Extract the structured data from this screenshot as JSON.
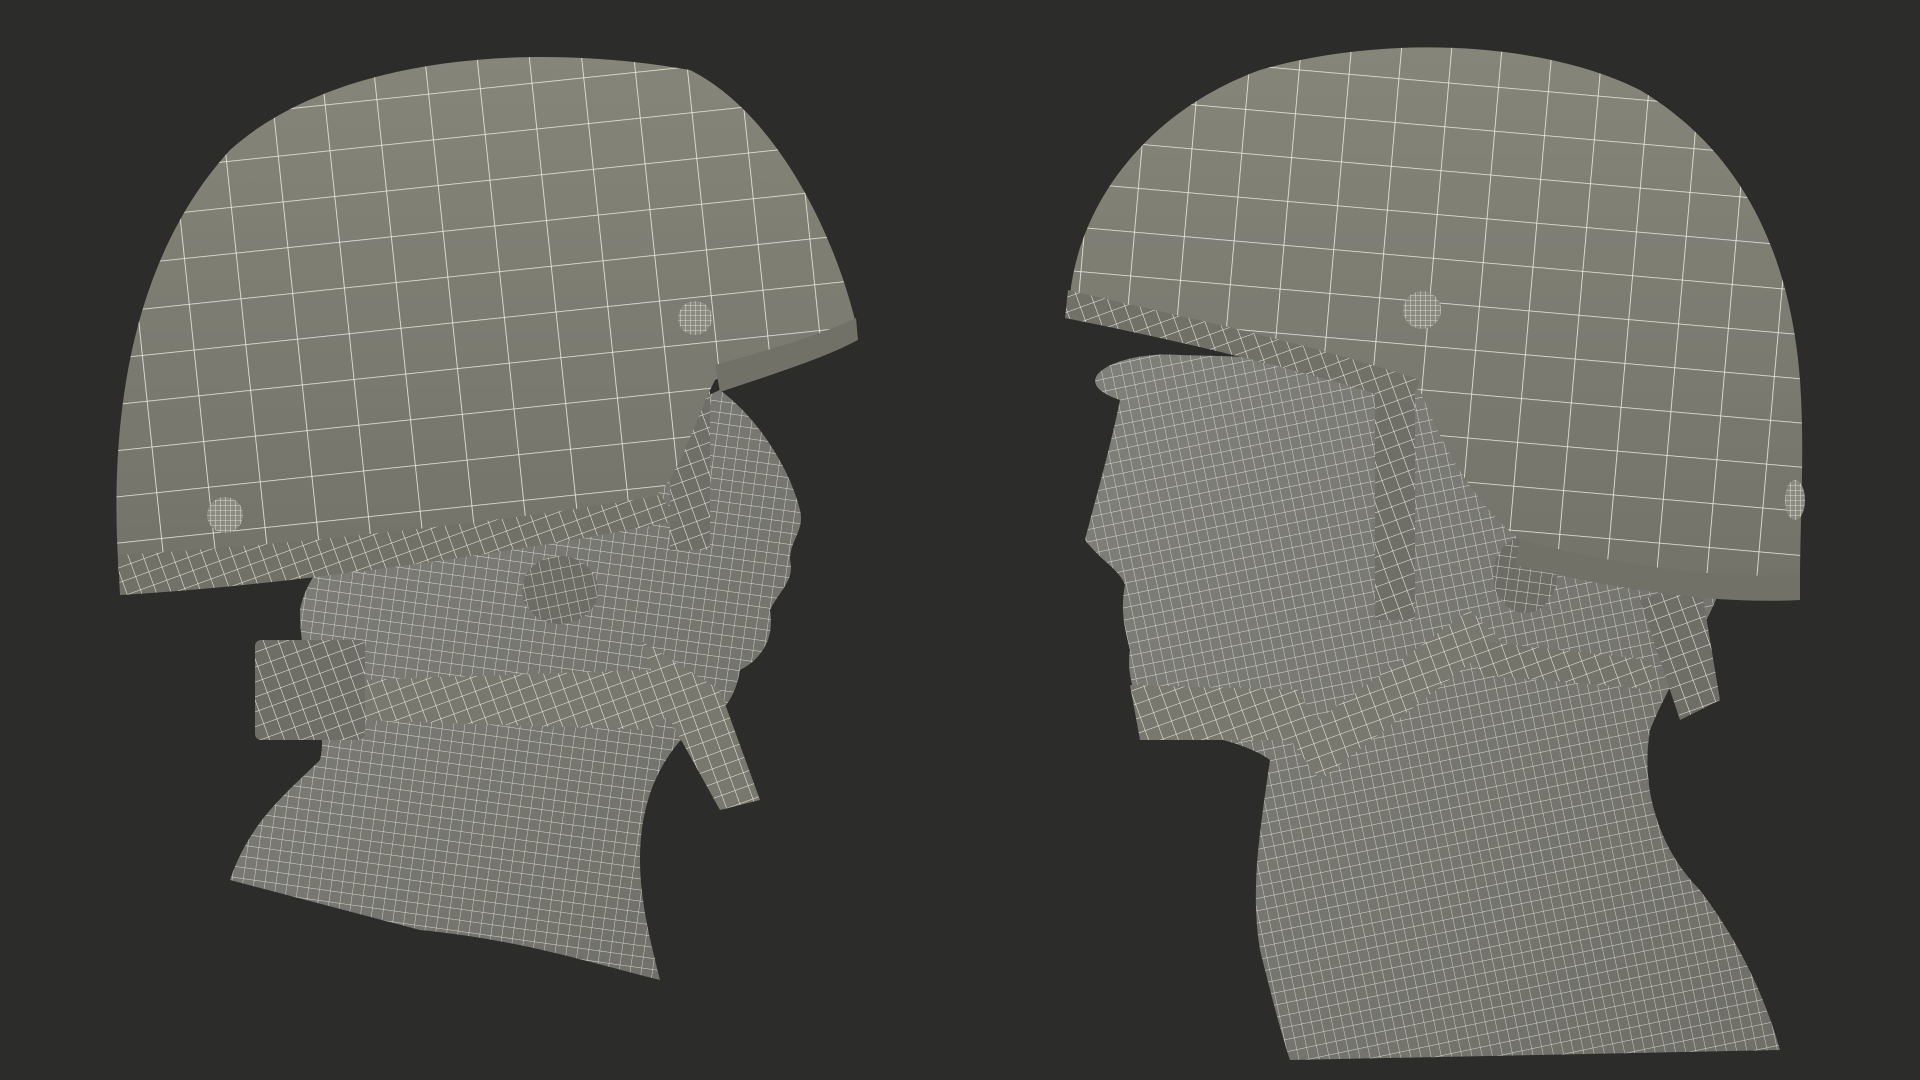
{
  "scene": {
    "background_color": "#2c2c2b",
    "mesh_fill_color": "#7c7c73",
    "mesh_shadow_color": "#5f5f57",
    "wire_color": "#e9e9df",
    "models": [
      {
        "name": "helmet-head-left-profile",
        "facing": "right"
      },
      {
        "name": "helmet-head-three-quarter",
        "facing": "left"
      }
    ]
  }
}
